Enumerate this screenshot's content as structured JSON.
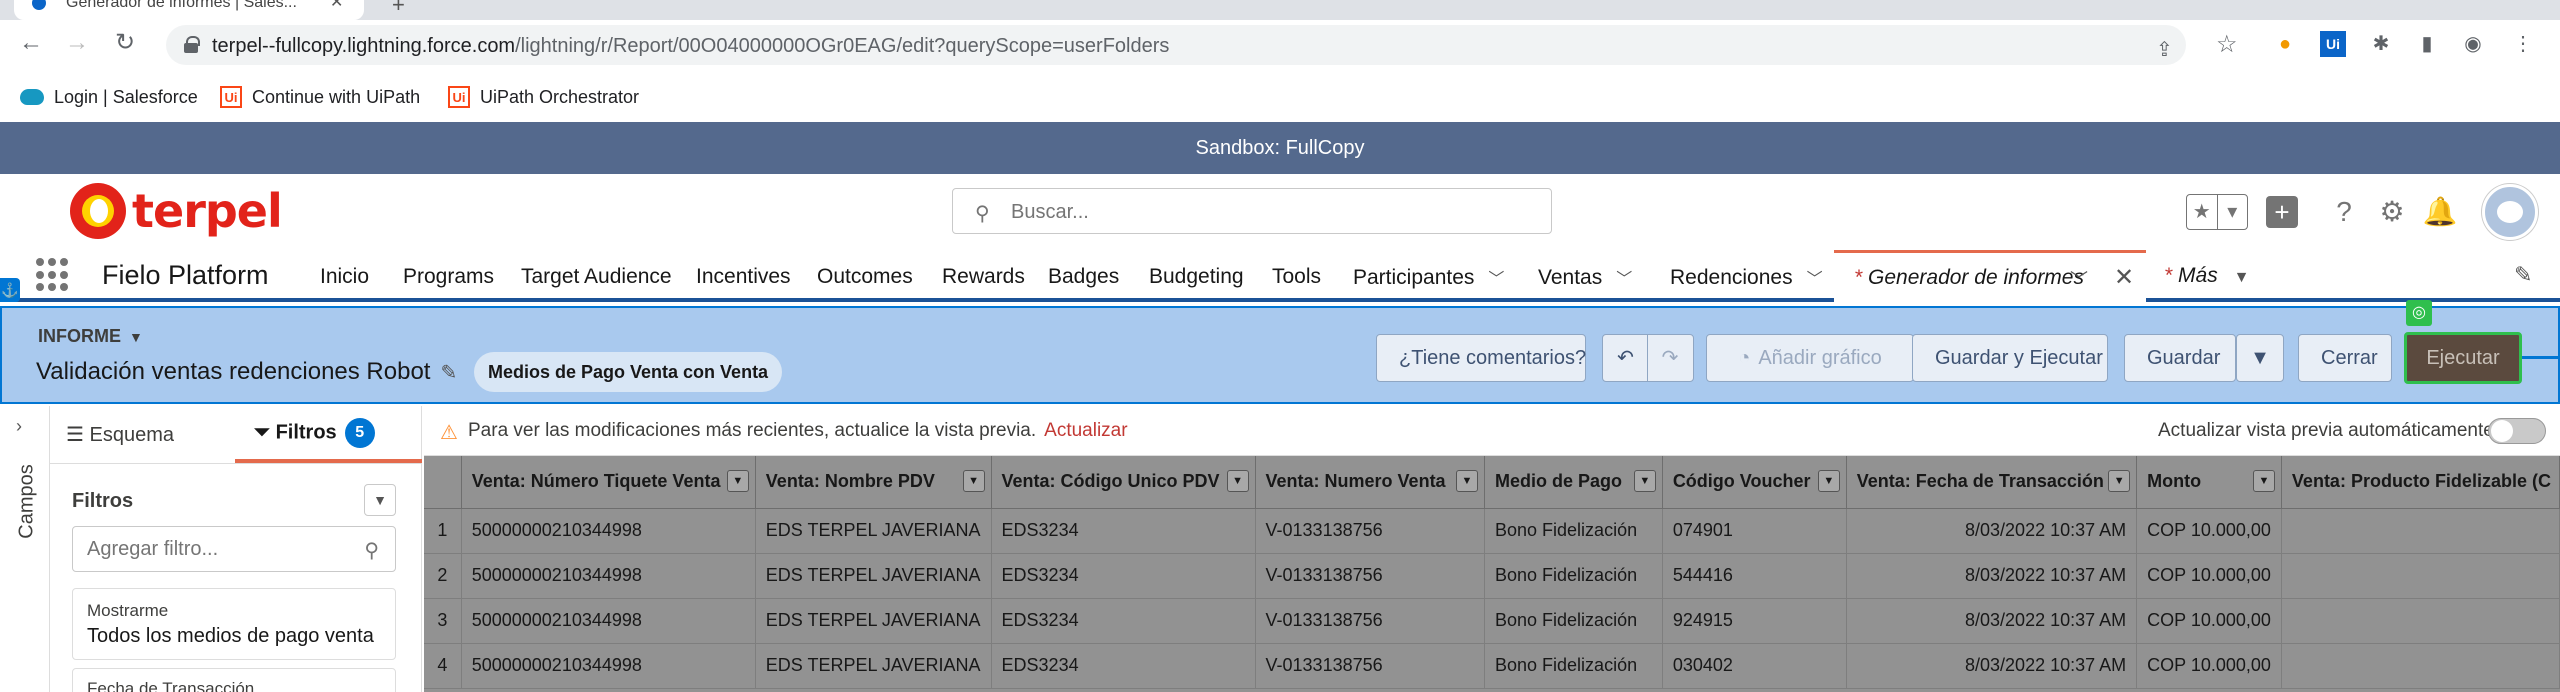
{
  "browser": {
    "tab_title": "Generador de informes | Sales...",
    "url_host": "terpel--fullcopy.lightning.force.com",
    "url_path": "/lightning/r/Report/00O04000000OGr0EAG/edit?queryScope=userFolders",
    "bookmarks": [
      {
        "label": "Login | Salesforce",
        "icon": "salesforce-cloud-icon"
      },
      {
        "label": "Continue with UiPath",
        "icon": "uipath-icon"
      },
      {
        "label": "UiPath Orchestrator",
        "icon": "uipath-icon"
      }
    ]
  },
  "sandbox_banner": "Sandbox: FullCopy",
  "logo_text": "terpel",
  "search": {
    "placeholder": "Buscar..."
  },
  "app_name": "Fielo Platform",
  "nav": {
    "items": [
      "Inicio",
      "Programs",
      "Target Audience",
      "Incentives",
      "Outcomes",
      "Rewards",
      "Badges",
      "Budgeting",
      "Tools",
      "Participantes",
      "Ventas",
      "Redenciones"
    ],
    "active_tab": "Generador de informes",
    "more": "Más",
    "star": "*"
  },
  "report": {
    "type_label": "INFORME",
    "title": "Validación ventas redenciones Robot",
    "report_type_pill": "Medios de Pago Venta con Venta",
    "buttons": {
      "feedback": "¿Tiene comentarios?",
      "add_chart": "Añadir gráfico",
      "save_run": "Guardar y Ejecutar",
      "save": "Guardar",
      "close": "Cerrar",
      "run": "Ejecutar"
    }
  },
  "sidebar": {
    "rail_label": "Campos",
    "tab_outline": "Esquema",
    "tab_filters": "Filtros",
    "filter_count": "5",
    "filters_heading": "Filtros",
    "add_filter_placeholder": "Agregar filtro...",
    "cards": [
      {
        "label": "Mostrarme",
        "value": "Todos los medios de pago venta"
      },
      {
        "label": "Fecha de Transacción",
        "value": ""
      }
    ]
  },
  "preview": {
    "notice": "Para ver las modificaciones más recientes, actualice la vista previa.",
    "refresh_link": "Actualizar",
    "auto_label": "Actualizar vista previa automáticamente",
    "columns": [
      "Venta: Número Tiquete Venta",
      "Venta: Nombre PDV",
      "Venta: Código Unico PDV",
      "Venta: Numero Venta",
      "Medio de Pago",
      "Código Voucher",
      "Venta: Fecha de Transacción",
      "Monto",
      "Venta: Producto Fidelizable (C"
    ],
    "rows": [
      {
        "n": "1",
        "cells": [
          "50000000210344998",
          "EDS TERPEL JAVERIANA",
          "EDS3234",
          "V-0133138756",
          "Bono Fidelización",
          "074901",
          "8/03/2022 10:37 AM",
          "COP 10.000,00",
          ""
        ]
      },
      {
        "n": "2",
        "cells": [
          "50000000210344998",
          "EDS TERPEL JAVERIANA",
          "EDS3234",
          "V-0133138756",
          "Bono Fidelización",
          "544416",
          "8/03/2022 10:37 AM",
          "COP 10.000,00",
          ""
        ]
      },
      {
        "n": "3",
        "cells": [
          "50000000210344998",
          "EDS TERPEL JAVERIANA",
          "EDS3234",
          "V-0133138756",
          "Bono Fidelización",
          "924915",
          "8/03/2022 10:37 AM",
          "COP 10.000,00",
          ""
        ]
      },
      {
        "n": "4",
        "cells": [
          "50000000210344998",
          "EDS TERPEL JAVERIANA",
          "EDS3234",
          "V-0133138756",
          "Bono Fidelización",
          "030402",
          "8/03/2022 10:37 AM",
          "COP 10.000,00",
          ""
        ]
      }
    ]
  },
  "colors": {
    "sandbox": "#54698d",
    "brand": "#e2231a",
    "accent": "#0176d3",
    "active_tab": "#e46a4c"
  }
}
